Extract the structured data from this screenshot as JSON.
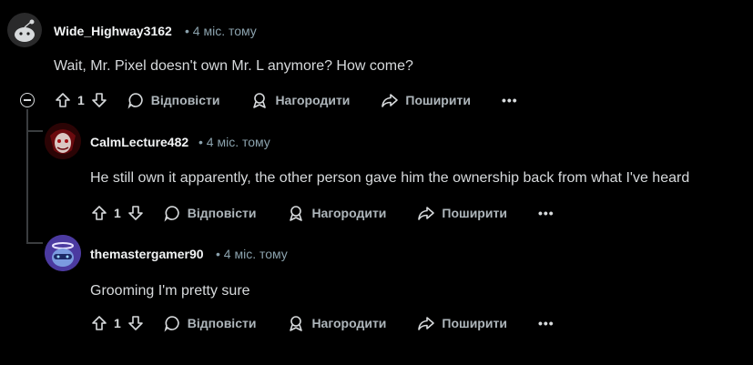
{
  "comments": [
    {
      "username": "Wide_Highway3162",
      "age": "• 4 міс. тому",
      "text": "Wait, Mr. Pixel doesn't own Mr. L anymore? How come?",
      "votes": "1"
    },
    {
      "username": "CalmLecture482",
      "age": "• 4 міс. тому",
      "text": "He still own it apparently, the other person gave him the ownership back from what I've heard",
      "votes": "1"
    },
    {
      "username": "themastergamer90",
      "age": "• 4 міс. тому",
      "text": "Grooming I'm pretty sure",
      "votes": "1"
    }
  ],
  "actions": {
    "reply": "Відповісти",
    "award": "Нагородити",
    "share": "Поширити",
    "more": "•••"
  },
  "colors": {
    "background": "#000000",
    "text": "#d7dadc",
    "meta": "#8ba2ad",
    "thread_line": "#3a3d3f"
  }
}
